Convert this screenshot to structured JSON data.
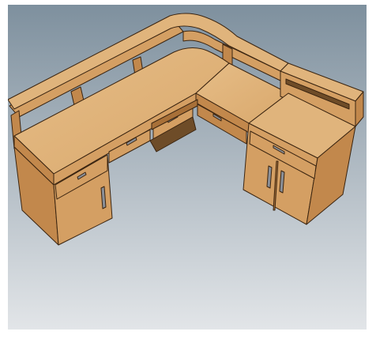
{
  "scene": {
    "subject": "l-shaped-wooden-desk",
    "colors": {
      "bg_top": "#7e909e",
      "bg_bottom": "#e2e5e8",
      "frame": "#ffffff",
      "wood_top": "#e0b47c",
      "wood_front": "#d49f63",
      "wood_side": "#c2884c",
      "wood_dark": "#a87038",
      "edge": "#3a2410",
      "handle": "#8a8f97",
      "recess": "#6e4c28"
    }
  }
}
